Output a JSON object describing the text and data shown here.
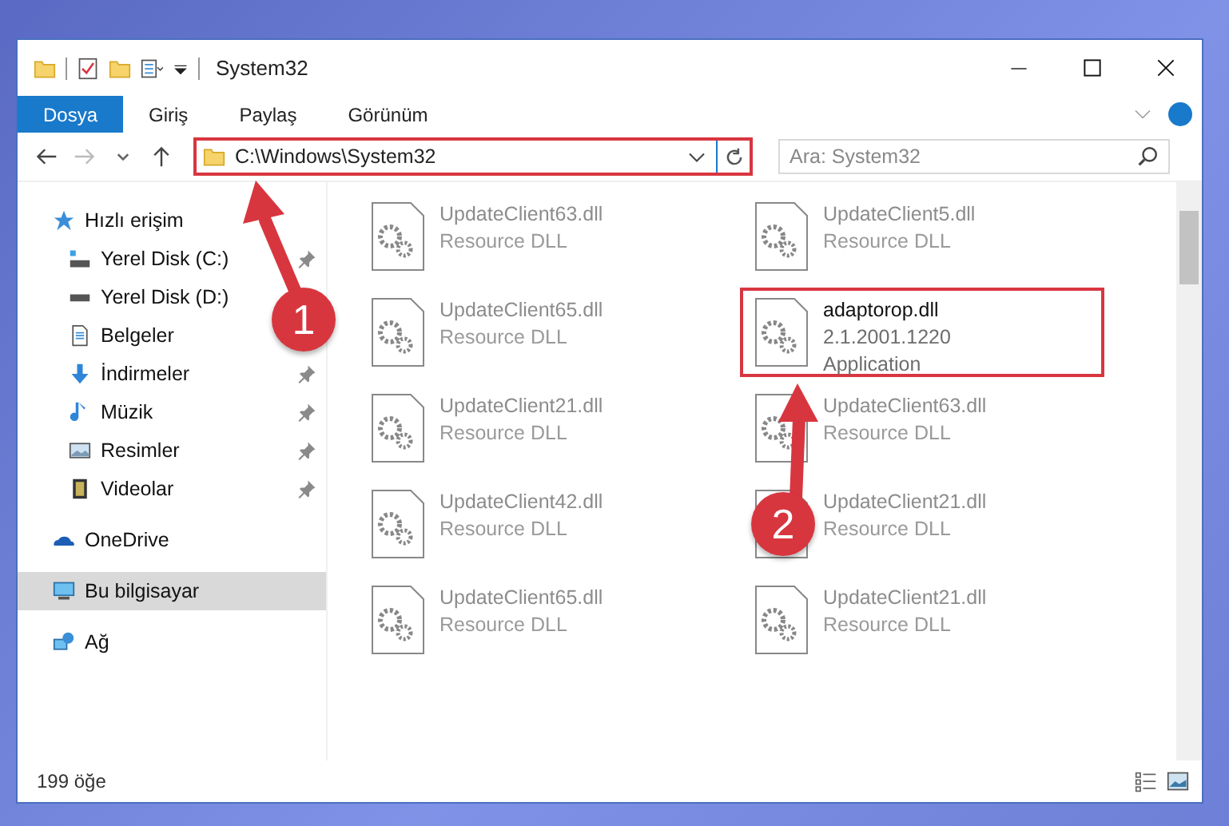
{
  "window": {
    "title": "System32"
  },
  "ribbon_tabs": [
    {
      "label": "Dosya",
      "selected": true
    },
    {
      "label": "Giriş",
      "selected": false
    },
    {
      "label": "Paylaş",
      "selected": false
    },
    {
      "label": "Görünüm",
      "selected": false
    }
  ],
  "address": {
    "path": "C:\\Windows\\System32",
    "highlighted": true
  },
  "search": {
    "placeholder": "Ara: System32"
  },
  "nav": [
    {
      "label": "Hızlı erişim",
      "kind": "star",
      "selected": false,
      "children": [
        {
          "label": "Yerel Disk (C:)",
          "kind": "system-disk",
          "pinned": true,
          "selected": false
        },
        {
          "label": "Yerel Disk (D:)",
          "kind": "disk",
          "pinned": false,
          "selected": false
        },
        {
          "label": "Belgeler",
          "kind": "document",
          "pinned": false,
          "selected": false
        },
        {
          "label": "İndirmeler",
          "kind": "download",
          "pinned": true,
          "selected": false
        },
        {
          "label": "Müzik",
          "kind": "music",
          "pinned": true,
          "selected": false
        },
        {
          "label": "Resimler",
          "kind": "image",
          "pinned": true,
          "selected": false
        },
        {
          "label": "Videolar",
          "kind": "film",
          "pinned": true,
          "selected": false
        }
      ]
    },
    {
      "label": "OneDrive",
      "kind": "cloud",
      "selected": false
    },
    {
      "label": "Bu bilgisayar",
      "kind": "computer",
      "selected": true
    },
    {
      "label": "Ağ",
      "kind": "network",
      "selected": false
    }
  ],
  "files": [
    {
      "name": "UpdateClient63.dll",
      "details": [
        "Resource DLL"
      ],
      "dimmed": true,
      "highlighted": false
    },
    {
      "name": "UpdateClient5.dll",
      "details": [
        "Resource DLL"
      ],
      "dimmed": true,
      "highlighted": false
    },
    {
      "name": "UpdateClient65.dll",
      "details": [
        "Resource DLL"
      ],
      "dimmed": true,
      "highlighted": false
    },
    {
      "name": "adaptorop.dll",
      "details": [
        "2.1.2001.1220",
        "Application"
      ],
      "dimmed": false,
      "highlighted": true
    },
    {
      "name": "UpdateClient21.dll",
      "details": [
        "Resource DLL"
      ],
      "dimmed": true,
      "highlighted": false
    },
    {
      "name": "UpdateClient63.dll",
      "details": [
        "Resource DLL"
      ],
      "dimmed": true,
      "highlighted": false
    },
    {
      "name": "UpdateClient42.dll",
      "details": [
        "Resource DLL"
      ],
      "dimmed": true,
      "highlighted": false
    },
    {
      "name": "UpdateClient21.dll",
      "details": [
        "Resource DLL"
      ],
      "dimmed": true,
      "highlighted": false
    },
    {
      "name": "UpdateClient65.dll",
      "details": [
        "Resource DLL"
      ],
      "dimmed": true,
      "highlighted": false
    },
    {
      "name": "UpdateClient21.dll",
      "details": [
        "Resource DLL"
      ],
      "dimmed": true,
      "highlighted": false
    }
  ],
  "annotations": [
    {
      "number": "1"
    },
    {
      "number": "2"
    }
  ],
  "status_bar": {
    "item_count": "199 öğe"
  }
}
